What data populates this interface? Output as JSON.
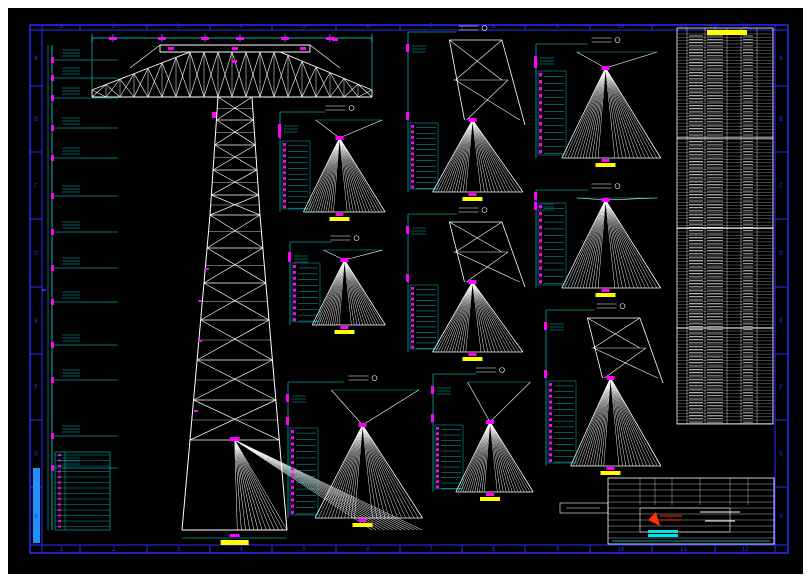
{
  "colors": {
    "background": "#000000",
    "frame": "#2b2bff",
    "geometry": "#ffffff",
    "dimension": "#00e5e5",
    "marker": "#ff00ff",
    "label": "#ffff00",
    "titleblock_accent": "#ff3300"
  },
  "grid": {
    "columns": [
      "1",
      "2",
      "3",
      "4",
      "5",
      "6",
      "7",
      "8",
      "9",
      "10",
      "11",
      "12"
    ],
    "rows": [
      "A",
      "B",
      "C",
      "D",
      "E",
      "F",
      "G",
      "H"
    ]
  },
  "title_block": {
    "logo_icon": "company-logo-icon"
  }
}
